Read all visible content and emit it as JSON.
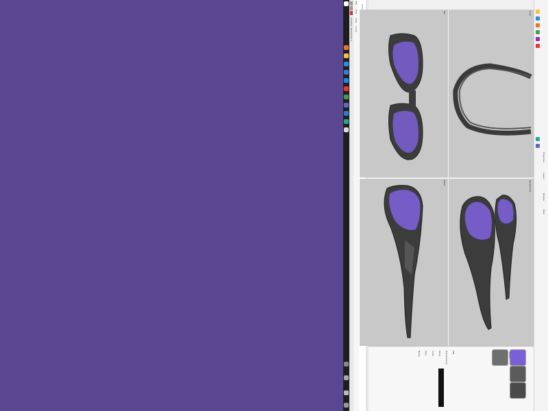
{
  "desktop": {
    "background": "#5a4691"
  },
  "app": {
    "title": "Untitled - Rhinoceros 7",
    "menu": [
      "File",
      "Edit",
      "View",
      "Curve",
      "Surface",
      "Solid",
      "Mesh",
      "Dimension",
      "Transform",
      "Tools",
      "Analyze",
      "Render",
      "Panels",
      "Help"
    ],
    "command_prompt": "Command:",
    "viewports": [
      {
        "label": "Top"
      },
      {
        "label": "Front"
      },
      {
        "label": "Right"
      },
      {
        "label": "Perspective"
      }
    ],
    "right_tabs": [
      "Properties",
      "Layers",
      "Display",
      "Help"
    ],
    "status": "Material Editor",
    "materials": [
      {
        "name": "Plastic"
      },
      {
        "name": "Lens"
      },
      {
        "name": "Metal"
      },
      {
        "name": "Rubber"
      }
    ],
    "property_fields": [
      "Name",
      "Type",
      "Color",
      "Gloss",
      "Transparency",
      "IOR"
    ]
  },
  "colors": {
    "lens": "#7b5fd6",
    "frame": "#3a3a3a",
    "viewport_bg": "#c8c8c8"
  }
}
